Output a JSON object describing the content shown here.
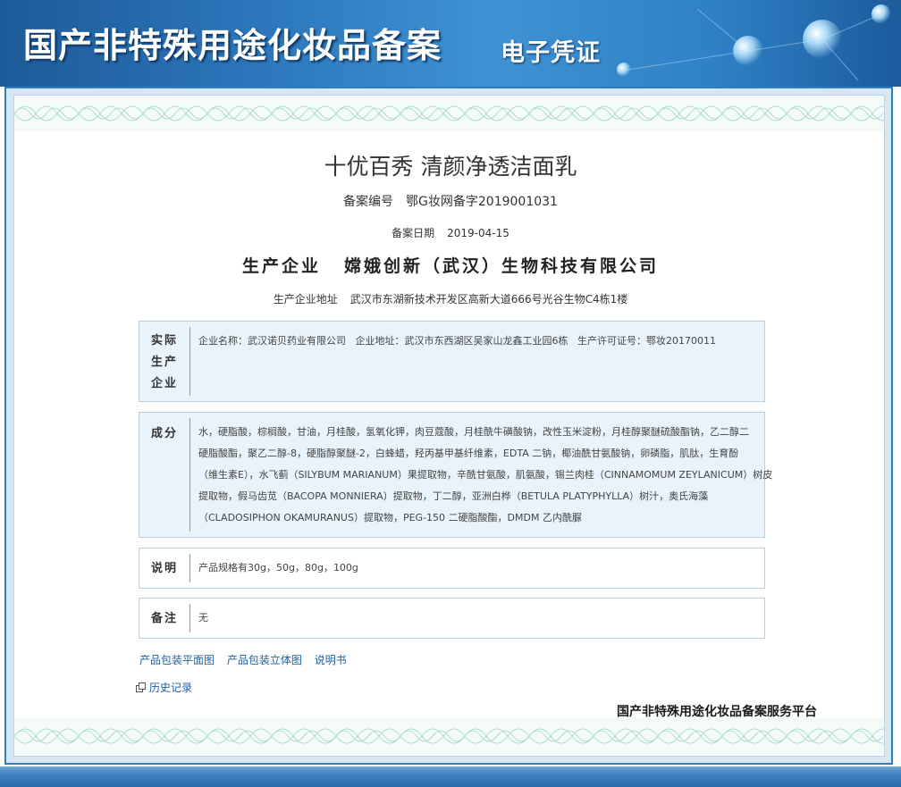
{
  "banner": {
    "title": "国产非特殊用途化妆品备案",
    "subtitle": "电子凭证"
  },
  "product": {
    "name": "十优百秀 清颜净透洁面乳",
    "record_no_label": "备案编号",
    "record_no": "鄂G妆网备字2019001031",
    "record_date_label": "备案日期",
    "record_date": "2019-04-15",
    "manufacturer_label": "生产企业",
    "manufacturer": "嫦娥创新（武汉）生物科技有限公司",
    "address_label": "生产企业地址",
    "address": "武汉市东湖新技术开发区高新大道666号光谷生物C4栋1楼"
  },
  "sections": {
    "actual": {
      "label_lines": [
        "实际",
        "生产",
        "企业"
      ],
      "text": "企业名称：武汉诺贝药业有限公司   企业地址：武汉市东西湖区吴家山龙鑫工业园6栋   生产许可证号：鄂妆20170011"
    },
    "ingredients": {
      "label": "成分",
      "lines": [
        "水，硬脂酸，棕榈酸，甘油，月桂酸，氢氧化钾，肉豆蔻酸，月桂酰牛磺酸钠，改性玉米淀粉，月桂醇聚醚硫酸酯钠，乙二醇二",
        "硬脂酸酯，聚乙二醇-8，硬脂醇聚醚-2，白蜂蜡，羟丙基甲基纤维素，EDTA 二钠，椰油酰甘氨酸钠，卵磷脂，肌肽，生育酚",
        "（维生素E），水飞蓟（SILYBUM MARIANUM）果提取物，辛酰甘氨酸，肌氨酸，锡兰肉桂（CINNAMOMUM ZEYLANICUM）树皮",
        "提取物，假马齿苋（BACOPA MONNIERA）提取物，丁二醇，亚洲白桦（BETULA PLATYPHYLLA）树汁，奥氏海藻",
        "（CLADOSIPHON OKAMURANUS）提取物，PEG-150 二硬脂酸酯，DMDM 乙内酰脲"
      ]
    },
    "notes": {
      "label": "说明",
      "text": "产品规格有30g，50g，80g，100g"
    },
    "remarks": {
      "label": "备注",
      "text": "无"
    }
  },
  "links": {
    "flat_image": "产品包装平面图",
    "3d_image": "产品包装立体图",
    "manual": "说明书",
    "history": "历史记录"
  },
  "platform": "国产非特殊用途化妆品备案服务平台",
  "colors": {
    "banner_blue": "#2d78bd",
    "link_blue": "#1e5fa3",
    "section_bg": "#e8f3fb",
    "frame_border": "#2f7cc0"
  }
}
